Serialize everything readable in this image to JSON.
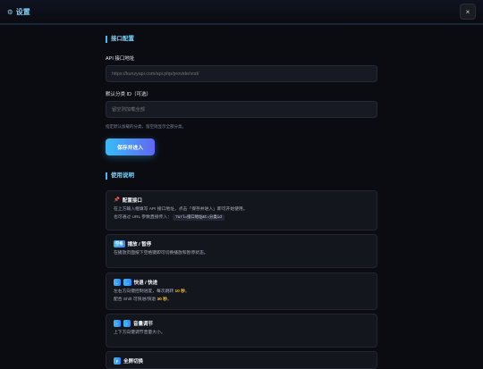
{
  "header": {
    "title": "设置",
    "close_label": "×"
  },
  "interface": {
    "section_title": "接口配置",
    "api_label": "API 接口地址",
    "api_placeholder": "https://kunzyapi.com/api.php/provide/vod/",
    "category_label": "默认分类 ID（可选）",
    "category_placeholder": "留空则加载全部",
    "hint": "指定默认加载的分类，留空则显示全部分类。",
    "save_label": "保存并进入"
  },
  "usage": {
    "section_title": "使用说明",
    "cards": [
      {
        "title": "配置接口",
        "lines": [
          "在上方输入框填写 API 接口地址，点击「保存并进入」即可开始使用。",
          "也可通过 URL 参数直接传入："
        ],
        "code": "?url=接口地址&t=分类id"
      },
      {
        "key": "空格",
        "title": "播放 / 暂停",
        "lines": [
          "在播放页面按下空格键即可切换播放和暂停状态。"
        ]
      },
      {
        "keys": [
          "←",
          "→"
        ],
        "title": "快退 / 快进",
        "line1_pre": "左右方向键控制进度，每次跳转 ",
        "line1_hl": "10 秒",
        "line1_post": "。",
        "line2_pre": "配合 Shift 可快进/快退 ",
        "line2_hl": "30 秒",
        "line2_post": "。"
      },
      {
        "keys": [
          "↑",
          "↓"
        ],
        "title": "音量调节",
        "lines": [
          "上下方向键调节音量大小。"
        ]
      },
      {
        "key": "F",
        "title": "全屏切换"
      }
    ]
  },
  "colors": {
    "accent": "#38bdf8",
    "accent2": "#6366f1",
    "highlight": "#fbbf24",
    "background": "#0b0c12"
  },
  "icons": {
    "title_icon": "gear-icon",
    "pin_icon": "pushpin-icon"
  }
}
